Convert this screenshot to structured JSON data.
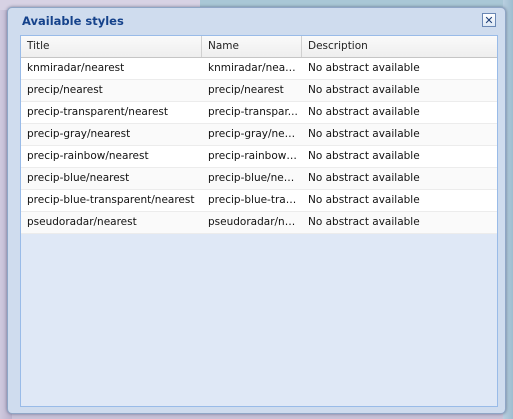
{
  "window": {
    "title": "Available styles",
    "close_glyph": "✕"
  },
  "grid": {
    "columns": [
      "Title",
      "Name",
      "Description"
    ],
    "rows": [
      {
        "title": "knmiradar/nearest",
        "name": "knmiradar/nearest",
        "description": "No abstract available"
      },
      {
        "title": "precip/nearest",
        "name": "precip/nearest",
        "description": "No abstract available"
      },
      {
        "title": "precip-transparent/nearest",
        "name": "precip-transpar...",
        "description": "No abstract available"
      },
      {
        "title": "precip-gray/nearest",
        "name": "precip-gray/nea...",
        "description": "No abstract available"
      },
      {
        "title": "precip-rainbow/nearest",
        "name": "precip-rainbow/...",
        "description": "No abstract available"
      },
      {
        "title": "precip-blue/nearest",
        "name": "precip-blue/near...",
        "description": "No abstract available"
      },
      {
        "title": "precip-blue-transparent/nearest",
        "name": "precip-blue-tran...",
        "description": "No abstract available"
      },
      {
        "title": "pseudoradar/nearest",
        "name": "pseudoradar/ne...",
        "description": "No abstract available"
      }
    ]
  }
}
